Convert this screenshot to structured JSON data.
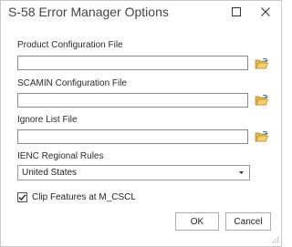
{
  "window": {
    "title": "S-58 Error Manager Options"
  },
  "product_config": {
    "label": "Product Configuration File",
    "value": ""
  },
  "scamin_config": {
    "label": "SCAMIN Configuration File",
    "value": ""
  },
  "ignore_list": {
    "label": "Ignore List File",
    "value": ""
  },
  "ienc_rules": {
    "label": "IENC Regional Rules",
    "selected": "United States"
  },
  "clip_features": {
    "label": "Clip Features at M_CSCL",
    "checked": true
  },
  "buttons": {
    "ok": "OK",
    "cancel": "Cancel"
  },
  "icons": {
    "maximize": "maximize-icon",
    "close": "close-icon",
    "browse": "folder-open-icon",
    "dropdown": "chevron-down-icon",
    "check": "checkmark-icon",
    "resize": "resize-grip-icon"
  },
  "colors": {
    "folder": "#e8b84a",
    "folder_arrow": "#3a7fd5"
  }
}
